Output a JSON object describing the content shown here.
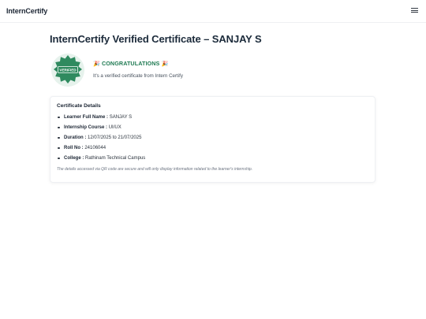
{
  "navbar": {
    "brand": "InternCertify",
    "menu_icon": "hamburger-menu-icon"
  },
  "header": {
    "title": "InternCertify Verified Certificate – SANJAY S"
  },
  "badge": {
    "icon": "verified-badge-icon",
    "text": "VERIFIED",
    "color": "#2f8a5f"
  },
  "congrats": {
    "emoji_left": "🎉",
    "text": "CONGRATULATIONS",
    "emoji_right": "🎉",
    "subtext": "It's a verified certificate from Intern Certify"
  },
  "details": {
    "title": "Certificate Details",
    "items": [
      {
        "label": "Learner Full Name :",
        "value": "SANJAY S"
      },
      {
        "label": "Internship Course :",
        "value": "UI/UX"
      },
      {
        "label": "Duration :",
        "value": "12/07/2025 to 21/07/2025"
      },
      {
        "label": "Roll No :",
        "value": "24106044"
      },
      {
        "label": "College :",
        "value": "Rathinam Technical Campus"
      }
    ],
    "note": "The details accessed via QR code are secure and will only display information related to the learner's internship."
  }
}
